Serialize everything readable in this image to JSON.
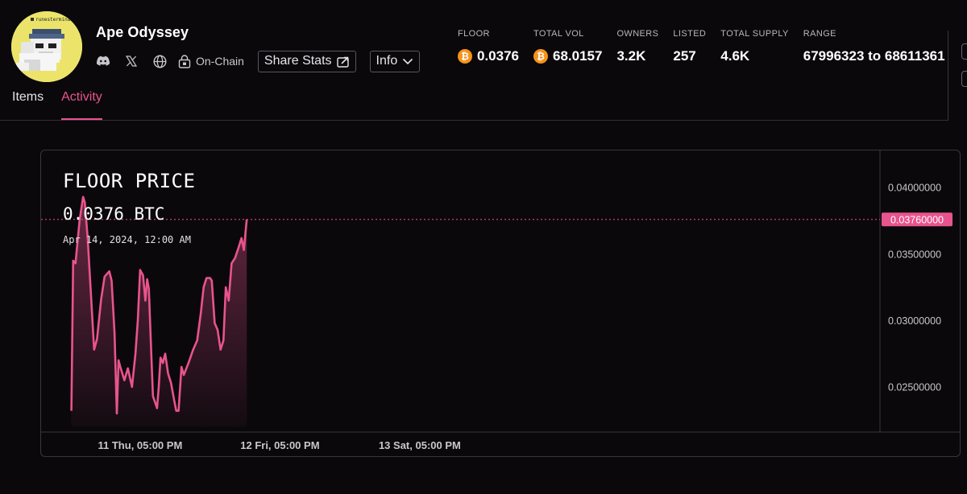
{
  "collection": {
    "name": "Ape Odyssey",
    "avatar_caption": "runesterminal"
  },
  "social": {
    "onchain_label": "On-Chain",
    "share_label": "Share Stats",
    "info_label": "Info"
  },
  "stats": [
    {
      "label": "FLOOR",
      "value": "0.0376",
      "btc": true
    },
    {
      "label": "TOTAL VOL",
      "value": "68.0157",
      "btc": true
    },
    {
      "label": "OWNERS",
      "value": "3.2K",
      "btc": false
    },
    {
      "label": "LISTED",
      "value": "257",
      "btc": false
    },
    {
      "label": "TOTAL SUPPLY",
      "value": "4.6K",
      "btc": false
    },
    {
      "label": "RANGE",
      "value": "67996323 to 68611361",
      "btc": false
    }
  ],
  "tabs": [
    {
      "label": "Items",
      "active": false
    },
    {
      "label": "Activity",
      "active": true
    }
  ],
  "colors": {
    "accent": "#e8548d",
    "background": "#0b080c",
    "btc_orange": "#f7931a"
  },
  "chart": {
    "title": "FLOOR PRICE",
    "current_value": "0.0376 BTC",
    "current_date": "Apr 14, 2024, 12:00 AM",
    "current_badge": "0.03760000"
  },
  "chart_data": {
    "type": "area",
    "title": "FLOOR PRICE",
    "ylim": [
      0.0216,
      0.0428
    ],
    "y_ticks": [
      {
        "value": 0.04,
        "label": "0.04000000"
      },
      {
        "value": 0.035,
        "label": "0.03500000"
      },
      {
        "value": 0.03,
        "label": "0.03000000"
      },
      {
        "value": 0.025,
        "label": "0.02500000"
      }
    ],
    "x_ticks": [
      {
        "hour": 17,
        "label": "11 Thu, 05:00 PM"
      },
      {
        "hour": 41,
        "label": "12 Fri, 05:00 PM"
      },
      {
        "hour": 65,
        "label": "13 Sat, 05:00 PM"
      }
    ],
    "x_range_hours": [
      0,
      144
    ],
    "current_y": 0.0376,
    "grid": false,
    "series": [
      {
        "points": [
          [
            5.2,
            0.0232
          ],
          [
            5.5,
            0.0345
          ],
          [
            5.9,
            0.0343
          ],
          [
            6.6,
            0.0375
          ],
          [
            7.2,
            0.0393
          ],
          [
            7.5,
            0.0389
          ],
          [
            8.0,
            0.0362
          ],
          [
            8.6,
            0.0316
          ],
          [
            9.1,
            0.0278
          ],
          [
            9.6,
            0.0286
          ],
          [
            10.3,
            0.0316
          ],
          [
            10.9,
            0.0333
          ],
          [
            11.7,
            0.0337
          ],
          [
            12.1,
            0.033
          ],
          [
            12.6,
            0.0291
          ],
          [
            13.0,
            0.023
          ],
          [
            13.3,
            0.027
          ],
          [
            13.6,
            0.0265
          ],
          [
            14.3,
            0.0255
          ],
          [
            14.9,
            0.0264
          ],
          [
            15.3,
            0.0256
          ],
          [
            15.6,
            0.025
          ],
          [
            16.2,
            0.0275
          ],
          [
            16.6,
            0.03
          ],
          [
            17.0,
            0.0338
          ],
          [
            17.5,
            0.0334
          ],
          [
            17.9,
            0.0315
          ],
          [
            18.2,
            0.0331
          ],
          [
            18.5,
            0.0324
          ],
          [
            18.9,
            0.0277
          ],
          [
            19.2,
            0.0243
          ],
          [
            19.6,
            0.0238
          ],
          [
            19.9,
            0.0234
          ],
          [
            20.2,
            0.025
          ],
          [
            20.5,
            0.0272
          ],
          [
            20.9,
            0.0268
          ],
          [
            21.3,
            0.0275
          ],
          [
            21.8,
            0.026
          ],
          [
            22.3,
            0.0253
          ],
          [
            22.8,
            0.0241
          ],
          [
            23.2,
            0.0232
          ],
          [
            23.6,
            0.0232
          ],
          [
            24.1,
            0.0265
          ],
          [
            24.5,
            0.0259
          ],
          [
            25.3,
            0.0268
          ],
          [
            26.1,
            0.0278
          ],
          [
            26.8,
            0.0285
          ],
          [
            27.4,
            0.0305
          ],
          [
            27.9,
            0.0325
          ],
          [
            28.4,
            0.0332
          ],
          [
            29.0,
            0.0332
          ],
          [
            29.3,
            0.033
          ],
          [
            29.8,
            0.0298
          ],
          [
            30.3,
            0.0293
          ],
          [
            30.8,
            0.0278
          ],
          [
            31.3,
            0.0285
          ],
          [
            31.7,
            0.0325
          ],
          [
            32.2,
            0.0315
          ],
          [
            32.7,
            0.0343
          ],
          [
            33.3,
            0.0347
          ],
          [
            33.9,
            0.0355
          ],
          [
            34.4,
            0.0362
          ],
          [
            34.8,
            0.0353
          ],
          [
            35.3,
            0.0376
          ]
        ]
      }
    ]
  }
}
